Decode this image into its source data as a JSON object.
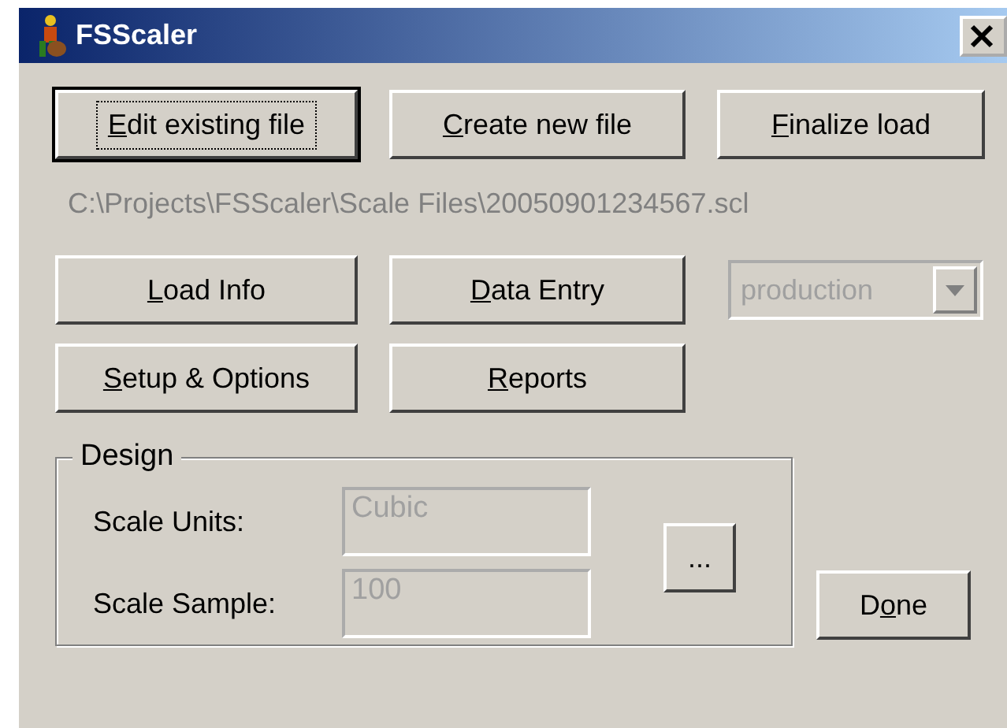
{
  "window": {
    "title": "FSScaler"
  },
  "top_buttons": [
    {
      "key": "E",
      "after": "dit existing file",
      "default": true
    },
    {
      "key": "C",
      "after": "reate new file",
      "default": false
    },
    {
      "key": "F",
      "after": "inalize load",
      "default": false
    }
  ],
  "file_path": "C:\\Projects\\FSScaler\\Scale Files\\20050901234567.scl",
  "middle_buttons": [
    {
      "key": "L",
      "after": "oad Info"
    },
    {
      "key": "D",
      "after": "ata Entry"
    },
    {
      "key": "S",
      "after": "etup & Options"
    },
    {
      "key": "R",
      "after": "eports"
    }
  ],
  "mode_dropdown": {
    "value": "production",
    "disabled": true
  },
  "design": {
    "title": "Design",
    "fields": [
      {
        "label": "Scale Units:",
        "value": "Cubic",
        "disabled": true
      },
      {
        "label": "Scale Sample:",
        "value": "100",
        "disabled": true
      }
    ],
    "browse_button": "..."
  },
  "done_button": {
    "before": "D",
    "key": "o",
    "after": "ne"
  }
}
